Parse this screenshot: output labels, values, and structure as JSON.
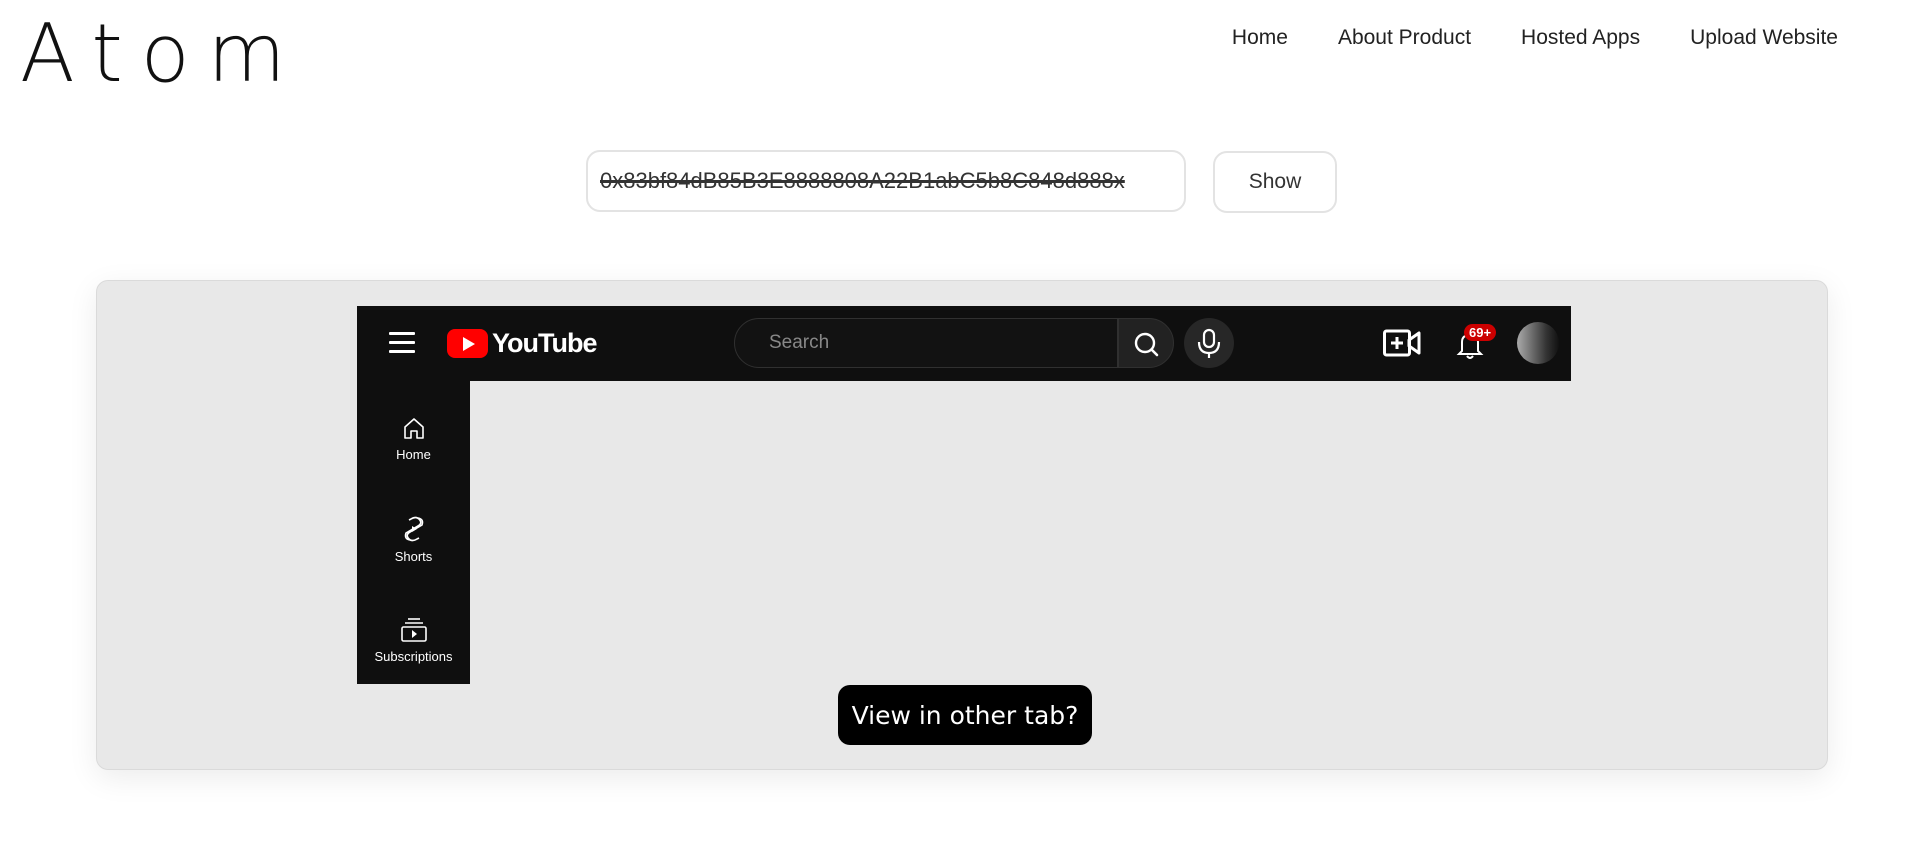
{
  "brand": {
    "logo": "Atom"
  },
  "nav": {
    "items": [
      {
        "label": "Home"
      },
      {
        "label": "About Product"
      },
      {
        "label": "Hosted Apps"
      },
      {
        "label": "Upload Website"
      }
    ]
  },
  "address_bar": {
    "value": "0x83bf84dB85B3E8888808A22B1abC5b8C848d888x"
  },
  "show_button": {
    "label": "Show"
  },
  "preview": {
    "youtube": {
      "logo_text": "YouTube",
      "search_placeholder": "Search",
      "notification_badge": "69+",
      "sidebar": [
        {
          "label": "Home",
          "icon": "home-icon"
        },
        {
          "label": "Shorts",
          "icon": "shorts-icon"
        },
        {
          "label": "Subscriptions",
          "icon": "subscriptions-icon"
        }
      ]
    },
    "view_tab_label": "View in other tab?"
  }
}
